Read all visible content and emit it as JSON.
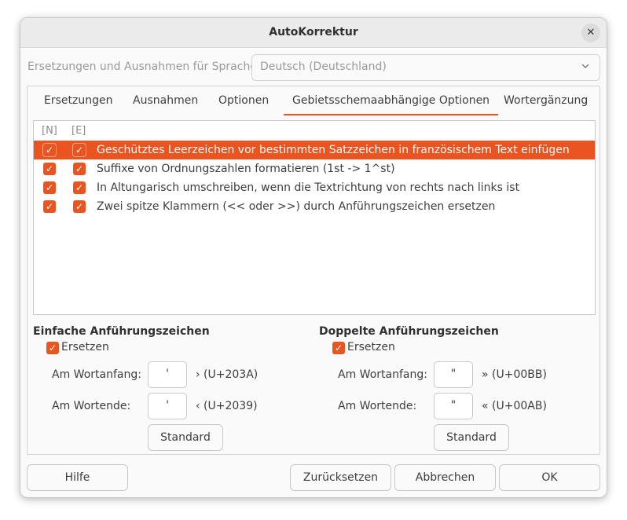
{
  "window": {
    "title": "AutoKorrektur"
  },
  "language": {
    "label": "Ersetzungen und Ausnahmen für Sprache:",
    "selected": "Deutsch (Deutschland)"
  },
  "tabs": [
    {
      "label": "Ersetzungen",
      "active": false
    },
    {
      "label": "Ausnahmen",
      "active": false
    },
    {
      "label": "Optionen",
      "active": false
    },
    {
      "label": "Gebietsschemaabhängige Optionen",
      "active": true
    },
    {
      "label": "Wortergänzung",
      "active": false
    }
  ],
  "options_list": {
    "columns": [
      "[N]",
      "[E]"
    ],
    "rows": [
      {
        "n": true,
        "e": true,
        "text": "Geschütztes Leerzeichen vor bestimmten Satzzeichen in französischem Text einfügen",
        "selected": true
      },
      {
        "n": true,
        "e": true,
        "text": "Suffixe von Ordnungszahlen formatieren (1st -> 1^st)",
        "selected": false
      },
      {
        "n": true,
        "e": true,
        "text": "In Altungarisch umschreiben, wenn die Textrichtung von rechts nach links ist",
        "selected": false
      },
      {
        "n": true,
        "e": true,
        "text": "Zwei spitze Klammern (<< oder >>) durch Anführungszeichen ersetzen",
        "selected": false
      }
    ]
  },
  "single_quotes": {
    "title": "Einfache Anführungszeichen",
    "replace_label": "Ersetzen",
    "replace_checked": true,
    "start_label": "Am Wortanfang:",
    "start_char": "'",
    "start_code": "› (U+203A)",
    "end_label": "Am Wortende:",
    "end_char": "'",
    "end_code": "‹ (U+2039)",
    "default_button": "Standard"
  },
  "double_quotes": {
    "title": "Doppelte Anführungszeichen",
    "replace_label": "Ersetzen",
    "replace_checked": true,
    "start_label": "Am Wortanfang:",
    "start_char": "\"",
    "start_code": "» (U+00BB)",
    "end_label": "Am Wortende:",
    "end_char": "\"",
    "end_code": "« (U+00AB)",
    "default_button": "Standard"
  },
  "buttons": {
    "help": "Hilfe",
    "reset": "Zurücksetzen",
    "cancel": "Abbrechen",
    "ok": "OK"
  },
  "icons": {
    "close": "close-icon",
    "dropdown": "chevron-down-icon",
    "check": "check-icon"
  },
  "colors": {
    "accent": "#e95420",
    "selected_text": "#ffffff"
  }
}
